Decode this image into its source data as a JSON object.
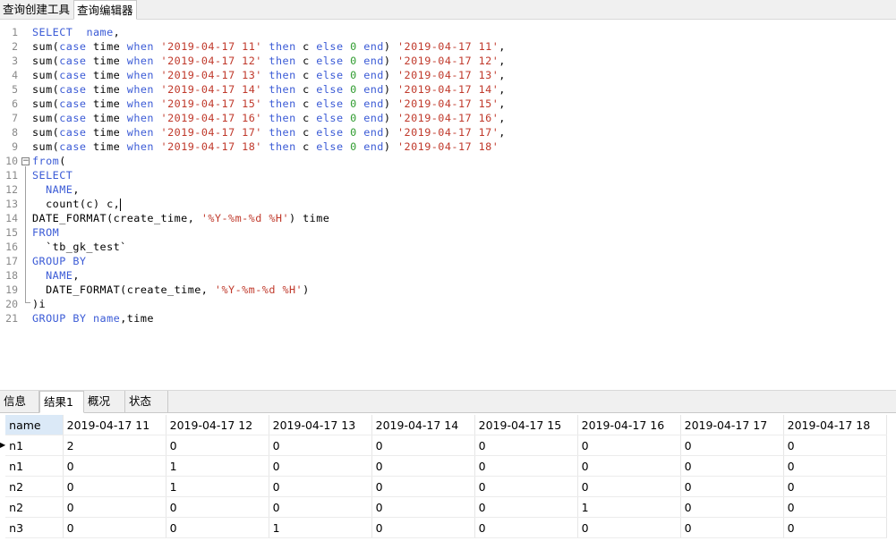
{
  "top_tabs": [
    "查询创建工具",
    "查询编辑器"
  ],
  "editor": {
    "lines": [
      {
        "n": "1",
        "tokens": [
          [
            "kw",
            "SELECT"
          ],
          [
            "",
            "  "
          ],
          [
            "kw",
            "name"
          ],
          [
            "",
            ","
          ]
        ]
      },
      {
        "n": "2",
        "tokens": [
          [
            "",
            "sum("
          ],
          [
            "kw",
            "case"
          ],
          [
            "",
            " time "
          ],
          [
            "kw",
            "when"
          ],
          [
            "",
            " "
          ],
          [
            "str",
            "'2019-04-17 11'"
          ],
          [
            "",
            " "
          ],
          [
            "kw",
            "then"
          ],
          [
            "",
            " c "
          ],
          [
            "kw",
            "else"
          ],
          [
            "",
            " "
          ],
          [
            "num",
            "0"
          ],
          [
            "",
            " "
          ],
          [
            "kw",
            "end"
          ],
          [
            "",
            ") "
          ],
          [
            "str",
            "'2019-04-17 11'"
          ],
          [
            "",
            ","
          ]
        ]
      },
      {
        "n": "3",
        "tokens": [
          [
            "",
            "sum("
          ],
          [
            "kw",
            "case"
          ],
          [
            "",
            " time "
          ],
          [
            "kw",
            "when"
          ],
          [
            "",
            " "
          ],
          [
            "str",
            "'2019-04-17 12'"
          ],
          [
            "",
            " "
          ],
          [
            "kw",
            "then"
          ],
          [
            "",
            " c "
          ],
          [
            "kw",
            "else"
          ],
          [
            "",
            " "
          ],
          [
            "num",
            "0"
          ],
          [
            "",
            " "
          ],
          [
            "kw",
            "end"
          ],
          [
            "",
            ") "
          ],
          [
            "str",
            "'2019-04-17 12'"
          ],
          [
            "",
            ","
          ]
        ]
      },
      {
        "n": "4",
        "tokens": [
          [
            "",
            "sum("
          ],
          [
            "kw",
            "case"
          ],
          [
            "",
            " time "
          ],
          [
            "kw",
            "when"
          ],
          [
            "",
            " "
          ],
          [
            "str",
            "'2019-04-17 13'"
          ],
          [
            "",
            " "
          ],
          [
            "kw",
            "then"
          ],
          [
            "",
            " c "
          ],
          [
            "kw",
            "else"
          ],
          [
            "",
            " "
          ],
          [
            "num",
            "0"
          ],
          [
            "",
            " "
          ],
          [
            "kw",
            "end"
          ],
          [
            "",
            ") "
          ],
          [
            "str",
            "'2019-04-17 13'"
          ],
          [
            "",
            ","
          ]
        ]
      },
      {
        "n": "5",
        "tokens": [
          [
            "",
            "sum("
          ],
          [
            "kw",
            "case"
          ],
          [
            "",
            " time "
          ],
          [
            "kw",
            "when"
          ],
          [
            "",
            " "
          ],
          [
            "str",
            "'2019-04-17 14'"
          ],
          [
            "",
            " "
          ],
          [
            "kw",
            "then"
          ],
          [
            "",
            " c "
          ],
          [
            "kw",
            "else"
          ],
          [
            "",
            " "
          ],
          [
            "num",
            "0"
          ],
          [
            "",
            " "
          ],
          [
            "kw",
            "end"
          ],
          [
            "",
            ") "
          ],
          [
            "str",
            "'2019-04-17 14'"
          ],
          [
            "",
            ","
          ]
        ]
      },
      {
        "n": "6",
        "tokens": [
          [
            "",
            "sum("
          ],
          [
            "kw",
            "case"
          ],
          [
            "",
            " time "
          ],
          [
            "kw",
            "when"
          ],
          [
            "",
            " "
          ],
          [
            "str",
            "'2019-04-17 15'"
          ],
          [
            "",
            " "
          ],
          [
            "kw",
            "then"
          ],
          [
            "",
            " c "
          ],
          [
            "kw",
            "else"
          ],
          [
            "",
            " "
          ],
          [
            "num",
            "0"
          ],
          [
            "",
            " "
          ],
          [
            "kw",
            "end"
          ],
          [
            "",
            ") "
          ],
          [
            "str",
            "'2019-04-17 15'"
          ],
          [
            "",
            ","
          ]
        ]
      },
      {
        "n": "7",
        "tokens": [
          [
            "",
            "sum("
          ],
          [
            "kw",
            "case"
          ],
          [
            "",
            " time "
          ],
          [
            "kw",
            "when"
          ],
          [
            "",
            " "
          ],
          [
            "str",
            "'2019-04-17 16'"
          ],
          [
            "",
            " "
          ],
          [
            "kw",
            "then"
          ],
          [
            "",
            " c "
          ],
          [
            "kw",
            "else"
          ],
          [
            "",
            " "
          ],
          [
            "num",
            "0"
          ],
          [
            "",
            " "
          ],
          [
            "kw",
            "end"
          ],
          [
            "",
            ") "
          ],
          [
            "str",
            "'2019-04-17 16'"
          ],
          [
            "",
            ","
          ]
        ]
      },
      {
        "n": "8",
        "tokens": [
          [
            "",
            "sum("
          ],
          [
            "kw",
            "case"
          ],
          [
            "",
            " time "
          ],
          [
            "kw",
            "when"
          ],
          [
            "",
            " "
          ],
          [
            "str",
            "'2019-04-17 17'"
          ],
          [
            "",
            " "
          ],
          [
            "kw",
            "then"
          ],
          [
            "",
            " c "
          ],
          [
            "kw",
            "else"
          ],
          [
            "",
            " "
          ],
          [
            "num",
            "0"
          ],
          [
            "",
            " "
          ],
          [
            "kw",
            "end"
          ],
          [
            "",
            ") "
          ],
          [
            "str",
            "'2019-04-17 17'"
          ],
          [
            "",
            ","
          ]
        ]
      },
      {
        "n": "9",
        "tokens": [
          [
            "",
            "sum("
          ],
          [
            "kw",
            "case"
          ],
          [
            "",
            " time "
          ],
          [
            "kw",
            "when"
          ],
          [
            "",
            " "
          ],
          [
            "str",
            "'2019-04-17 18'"
          ],
          [
            "",
            " "
          ],
          [
            "kw",
            "then"
          ],
          [
            "",
            " c "
          ],
          [
            "kw",
            "else"
          ],
          [
            "",
            " "
          ],
          [
            "num",
            "0"
          ],
          [
            "",
            " "
          ],
          [
            "kw",
            "end"
          ],
          [
            "",
            ") "
          ],
          [
            "str",
            "'2019-04-17 18'"
          ]
        ]
      },
      {
        "n": "10",
        "tokens": [
          [
            "kw",
            "from"
          ],
          [
            "",
            "("
          ]
        ]
      },
      {
        "n": "11",
        "tokens": [
          [
            "kw",
            "SELECT"
          ]
        ]
      },
      {
        "n": "12",
        "tokens": [
          [
            "",
            "  "
          ],
          [
            "kw",
            "NAME"
          ],
          [
            "",
            ","
          ]
        ]
      },
      {
        "n": "13",
        "tokens": [
          [
            "",
            "  count(c) c,"
          ]
        ],
        "cursor": true
      },
      {
        "n": "14",
        "tokens": [
          [
            "",
            "DATE_FORMAT(create_time, "
          ],
          [
            "str",
            "'%Y-%m-%d %H'"
          ],
          [
            "",
            ") time"
          ]
        ]
      },
      {
        "n": "15",
        "tokens": [
          [
            "kw",
            "FROM"
          ]
        ]
      },
      {
        "n": "16",
        "tokens": [
          [
            "",
            "  `tb_gk_test`"
          ]
        ]
      },
      {
        "n": "17",
        "tokens": [
          [
            "kw",
            "GROUP BY"
          ]
        ]
      },
      {
        "n": "18",
        "tokens": [
          [
            "",
            "  "
          ],
          [
            "kw",
            "NAME"
          ],
          [
            "",
            ","
          ]
        ]
      },
      {
        "n": "19",
        "tokens": [
          [
            "",
            "  DATE_FORMAT(create_time, "
          ],
          [
            "str",
            "'%Y-%m-%d %H'"
          ],
          [
            "",
            ")"
          ]
        ]
      },
      {
        "n": "20",
        "tokens": [
          [
            "",
            ")i"
          ]
        ]
      },
      {
        "n": "21",
        "tokens": [
          [
            "kw",
            "GROUP BY"
          ],
          [
            "",
            " "
          ],
          [
            "kw",
            "name"
          ],
          [
            "",
            ",time"
          ]
        ]
      }
    ]
  },
  "bottom_tabs": [
    "信息",
    "结果1",
    "概况",
    "状态"
  ],
  "result": {
    "columns": [
      "name",
      "2019-04-17 11",
      "2019-04-17 12",
      "2019-04-17 13",
      "2019-04-17 14",
      "2019-04-17 15",
      "2019-04-17 16",
      "2019-04-17 17",
      "2019-04-17 18"
    ],
    "rows": [
      [
        "n1",
        "2",
        "0",
        "0",
        "0",
        "0",
        "0",
        "0",
        "0"
      ],
      [
        "n1",
        "0",
        "1",
        "0",
        "0",
        "0",
        "0",
        "0",
        "0"
      ],
      [
        "n2",
        "0",
        "1",
        "0",
        "0",
        "0",
        "0",
        "0",
        "0"
      ],
      [
        "n2",
        "0",
        "0",
        "0",
        "0",
        "0",
        "1",
        "0",
        "0"
      ],
      [
        "n3",
        "0",
        "0",
        "1",
        "0",
        "0",
        "0",
        "0",
        "0"
      ]
    ]
  },
  "colors": {
    "keyword": "#3b5bd6",
    "string": "#c0392b",
    "number": "#2e9b2e",
    "header_selected": "#dbe9f7"
  }
}
